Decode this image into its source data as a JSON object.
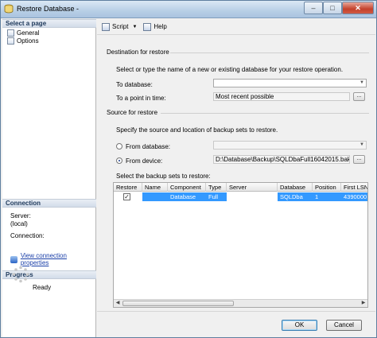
{
  "window": {
    "title": "Restore Database -",
    "minimize": "–",
    "maximize": "□",
    "close": "✕"
  },
  "sidebar": {
    "select_page_header": "Select a page",
    "pages": [
      {
        "label": "General"
      },
      {
        "label": "Options"
      }
    ],
    "connection_header": "Connection",
    "server_label": "Server:",
    "server_value": "(local)",
    "connection_label": "Connection:",
    "connection_value": "",
    "view_connection_link": "View connection properties",
    "progress_header": "Progress",
    "progress_status": "Ready"
  },
  "toolbar": {
    "script_label": "Script",
    "help_label": "Help"
  },
  "destination": {
    "title": "Destination for restore",
    "instruction": "Select or type the name of a new or existing database for your restore operation.",
    "to_database_label": "To database:",
    "to_database_value": "",
    "point_in_time_label": "To a point in time:",
    "point_in_time_value": "Most recent possible"
  },
  "source": {
    "title": "Source for restore",
    "instruction": "Specify the source and location of backup sets to restore.",
    "from_database_label": "From database:",
    "from_database_value": "",
    "from_device_label": "From device:",
    "from_device_value": "D:\\Database\\Backup\\SQLDbaFull16042015.bak",
    "selected_option": "from_device",
    "browse_label": "...",
    "backup_sets_label": "Select the backup sets to restore:"
  },
  "backup_table": {
    "columns": [
      "Restore",
      "Name",
      "Component",
      "Type",
      "Server",
      "Database",
      "Position",
      "First LSN"
    ],
    "rows": [
      {
        "restore": true,
        "name": "",
        "component": "Database",
        "type": "Full",
        "server": "",
        "database": "SQLDba",
        "position": "1",
        "first_lsn": "4390000"
      }
    ]
  },
  "footer": {
    "ok_label": "OK",
    "cancel_label": "Cancel"
  },
  "colors": {
    "selection": "#3399ff",
    "link": "#1a3fa8",
    "header_text": "#1e395b"
  }
}
